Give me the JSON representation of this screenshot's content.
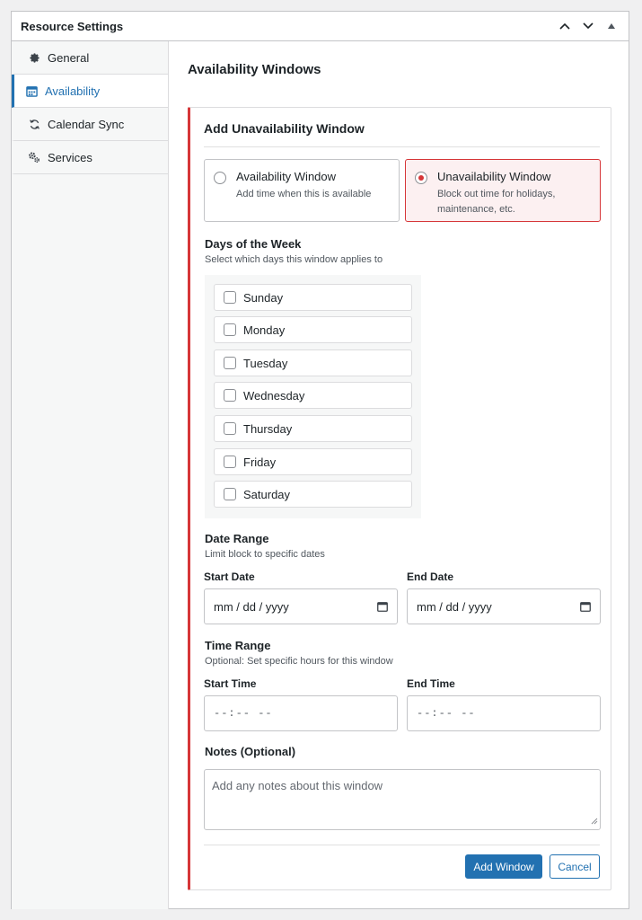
{
  "panel": {
    "title": "Resource Settings",
    "controls": [
      "chevron-up-icon",
      "chevron-down-icon",
      "caret-up-icon"
    ]
  },
  "sidebar": {
    "items": [
      {
        "label": "General",
        "icon": "gear-icon"
      },
      {
        "label": "Availability",
        "icon": "calendar-icon",
        "active": true
      },
      {
        "label": "Calendar Sync",
        "icon": "sync-icon"
      },
      {
        "label": "Services",
        "icon": "gears-icon"
      }
    ]
  },
  "main": {
    "title": "Availability Windows",
    "card": {
      "title": "Add Unavailability Window",
      "types": [
        {
          "label": "Availability Window",
          "desc": "Add time when this is available",
          "selected": false
        },
        {
          "label": "Unavailability Window",
          "desc": "Block out time for holidays, maintenance, etc.",
          "selected": true
        }
      ],
      "days_title": "Days of the Week",
      "days_desc": "Select which days this window applies to",
      "days": [
        "Sunday",
        "Monday",
        "Tuesday",
        "Wednesday",
        "Thursday",
        "Friday",
        "Saturday"
      ],
      "date_title": "Date Range",
      "date_desc": "Limit block to specific dates",
      "start_date_label": "Start Date",
      "end_date_label": "End Date",
      "date_placeholder": "mm / dd / yyyy",
      "time_title": "Time Range",
      "time_desc": "Optional: Set specific hours for this window",
      "start_time_label": "Start Time",
      "end_time_label": "End Time",
      "time_placeholder": "--:-- --",
      "notes_title": "Notes (Optional)",
      "notes_placeholder": "Add any notes about this window",
      "add_button": "Add Window",
      "cancel_button": "Cancel"
    }
  },
  "colors": {
    "accent": "#2271b1",
    "danger": "#d63638"
  }
}
